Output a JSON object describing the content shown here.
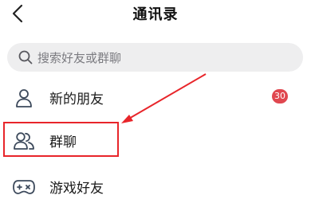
{
  "header": {
    "title": "通讯录",
    "back_icon": "chevron-left-icon"
  },
  "search": {
    "placeholder": "搜索好友或群聊",
    "icon": "search-icon"
  },
  "list": [
    {
      "label": "新的朋友",
      "icon": "person-icon",
      "badge": "30"
    },
    {
      "label": "群聊",
      "icon": "group-icon"
    },
    {
      "label": "游戏好友",
      "icon": "gamepad-icon"
    }
  ],
  "annotation": {
    "color": "#e8252a",
    "highlighted_item": "群聊"
  },
  "colors": {
    "badge": "#e0474f",
    "search_bg": "#eeeeef",
    "icon_stroke": "#3d4a5c"
  }
}
